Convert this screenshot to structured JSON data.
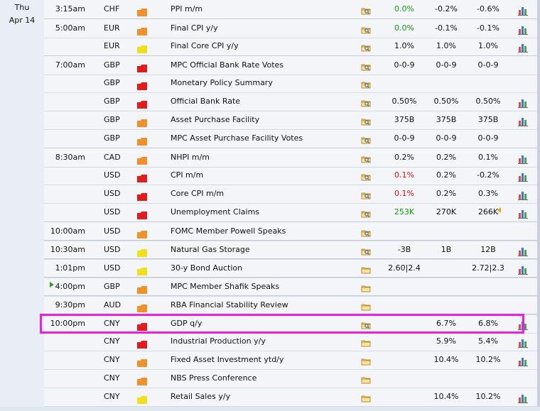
{
  "date": {
    "day": "Thu",
    "date": "Apr 14"
  },
  "colors": {
    "impact_high": "#e21b1b",
    "impact_medium": "#f0902a",
    "impact_low": "#f0df1a",
    "positive": "#129a12",
    "negative": "#d11111",
    "highlight": "#e61ee6"
  },
  "rows": [
    {
      "time": "3:15am",
      "currency": "CHF",
      "impact": "medium",
      "event": "PPI m/m",
      "icon": "folder-search-icon",
      "actual": "0.0%",
      "actual_color": "green",
      "forecast": "-0.2%",
      "previous": "-0.6%",
      "chart": true
    },
    {
      "time": "5:00am",
      "currency": "EUR",
      "impact": "medium",
      "event": "Final CPI y/y",
      "icon": "folder-search-icon",
      "actual": "0.0%",
      "actual_color": "green",
      "forecast": "-0.1%",
      "previous": "-0.1%",
      "chart": true
    },
    {
      "time": "",
      "currency": "EUR",
      "impact": "low",
      "event": "Final Core CPI y/y",
      "icon": "folder-search-icon",
      "actual": "1.0%",
      "forecast": "1.0%",
      "previous": "1.0%",
      "chart": true
    },
    {
      "time": "7:00am",
      "currency": "GBP",
      "impact": "high",
      "event": "MPC Official Bank Rate Votes",
      "icon": "folder-search-icon",
      "actual": "0-0-9",
      "forecast": "0-0-9",
      "previous": "0-0-9",
      "chart": false
    },
    {
      "time": "",
      "currency": "GBP",
      "impact": "high",
      "event": "Monetary Policy Summary",
      "icon": "folder-search-icon",
      "actual": "",
      "forecast": "",
      "previous": "",
      "chart": false
    },
    {
      "time": "",
      "currency": "GBP",
      "impact": "high",
      "event": "Official Bank Rate",
      "icon": "folder-search-icon",
      "actual": "0.50%",
      "forecast": "0.50%",
      "previous": "0.50%",
      "chart": true
    },
    {
      "time": "",
      "currency": "GBP",
      "impact": "medium",
      "event": "Asset Purchase Facility",
      "icon": "folder-search-icon",
      "actual": "375B",
      "forecast": "375B",
      "previous": "375B",
      "chart": true
    },
    {
      "time": "",
      "currency": "GBP",
      "impact": "medium",
      "event": "MPC Asset Purchase Facility Votes",
      "icon": "folder-search-icon",
      "actual": "0-0-9",
      "forecast": "0-0-9",
      "previous": "0-0-9",
      "chart": false
    },
    {
      "time": "8:30am",
      "currency": "CAD",
      "impact": "medium",
      "event": "NHPI m/m",
      "icon": "folder-search-icon",
      "actual": "0.2%",
      "forecast": "0.2%",
      "previous": "0.1%",
      "chart": true
    },
    {
      "time": "",
      "currency": "USD",
      "impact": "high",
      "event": "CPI m/m",
      "icon": "folder-search-icon",
      "actual": "0.1%",
      "actual_color": "red",
      "forecast": "0.2%",
      "previous": "-0.2%",
      "chart": true
    },
    {
      "time": "",
      "currency": "USD",
      "impact": "high",
      "event": "Core CPI m/m",
      "icon": "folder-search-icon",
      "actual": "0.1%",
      "actual_color": "red",
      "forecast": "0.2%",
      "previous": "0.3%",
      "chart": true
    },
    {
      "time": "",
      "currency": "USD",
      "impact": "high",
      "event": "Unemployment Claims",
      "icon": "folder-search-icon",
      "actual": "253K",
      "actual_color": "green",
      "forecast": "270K",
      "previous": "266K",
      "chart": true
    },
    {
      "time": "10:00am",
      "currency": "USD",
      "impact": "medium",
      "event": "FOMC Member Powell Speaks",
      "icon": "folder-search-icon",
      "actual": "",
      "forecast": "",
      "previous": "",
      "chart": false
    },
    {
      "time": "10:30am",
      "currency": "USD",
      "impact": "low",
      "event": "Natural Gas Storage",
      "icon": "folder-search-icon",
      "actual": "-3B",
      "forecast": "1B",
      "previous": "12B",
      "chart": true
    },
    {
      "time": "1:01pm",
      "currency": "USD",
      "impact": "low",
      "event": "30-y Bond Auction",
      "icon": "folder-icon",
      "actual": "2.60|2.4",
      "forecast": "",
      "previous": "2.72|2.3",
      "chart": true
    },
    {
      "time": "4:00pm",
      "currency": "GBP",
      "impact": "medium",
      "event": "MPC Member Shafik Speaks",
      "icon": "folder-icon",
      "actual": "",
      "forecast": "",
      "previous": "",
      "chart": false
    },
    {
      "time": "9:30pm",
      "currency": "AUD",
      "impact": "medium",
      "event": "RBA Financial Stability Review",
      "icon": "folder-icon",
      "actual": "",
      "forecast": "",
      "previous": "",
      "chart": false
    },
    {
      "time": "10:00pm",
      "currency": "CNY",
      "impact": "high",
      "event": "GDP q/y",
      "icon": "folder-search-icon",
      "actual": "",
      "forecast": "6.7%",
      "previous": "6.8%",
      "chart": true
    },
    {
      "time": "",
      "currency": "CNY",
      "impact": "high",
      "event": "Industrial Production y/y",
      "icon": "folder-icon",
      "actual": "",
      "forecast": "5.9%",
      "previous": "5.4%",
      "chart": true
    },
    {
      "time": "",
      "currency": "CNY",
      "impact": "medium",
      "event": "Fixed Asset Investment ytd/y",
      "icon": "folder-icon",
      "actual": "",
      "forecast": "10.4%",
      "previous": "10.2%",
      "chart": true
    },
    {
      "time": "",
      "currency": "CNY",
      "impact": "medium",
      "event": "NBS Press Conference",
      "icon": "folder-icon",
      "actual": "",
      "forecast": "",
      "previous": "",
      "chart": false
    },
    {
      "time": "",
      "currency": "CNY",
      "impact": "low",
      "event": "Retail Sales y/y",
      "icon": "folder-icon",
      "actual": "",
      "forecast": "10.4%",
      "previous": "10.2%",
      "chart": true
    }
  ]
}
